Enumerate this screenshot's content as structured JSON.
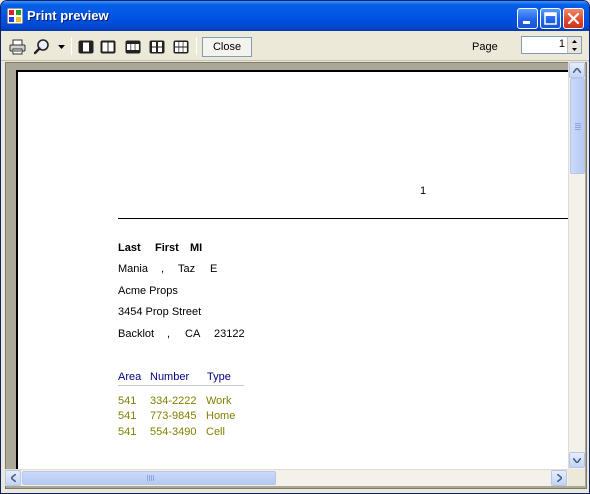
{
  "window": {
    "title": "Print preview"
  },
  "icons": {
    "app": "print-preview-app-icon",
    "print": "printer-icon",
    "zoom": "magnifier-icon",
    "zoom_dropdown": "dropdown-arrow-icon",
    "one_page": "one-page-icon",
    "two_pages": "two-pages-icon",
    "three_pages": "three-pages-icon",
    "four_pages": "four-pages-icon",
    "six_pages": "six-pages-icon"
  },
  "toolbar": {
    "close_label": "Close",
    "page_label": "Page",
    "page_value": "1"
  },
  "document": {
    "page_number": "1",
    "header": [
      "Last",
      "First",
      "MI"
    ],
    "name": {
      "last": "Mania",
      "comma": ",",
      "first": "Taz",
      "mi": "E"
    },
    "company": "Acme Props",
    "street": "3454 Prop Street",
    "city": {
      "name": "Backlot",
      "comma": ",",
      "state": "CA",
      "zip": "23122"
    },
    "phones_header": [
      "Area",
      "Number",
      "Type"
    ],
    "phones": [
      {
        "area": "541",
        "number": "334-2222",
        "type": "Work"
      },
      {
        "area": "541",
        "number": "773-9845",
        "type": "Home"
      },
      {
        "area": "541",
        "number": "554-3490",
        "type": "Cell"
      }
    ]
  },
  "colors": {
    "title_bar": "#0055e5",
    "phone_header": "#000080",
    "phone_rows": "#808000"
  }
}
